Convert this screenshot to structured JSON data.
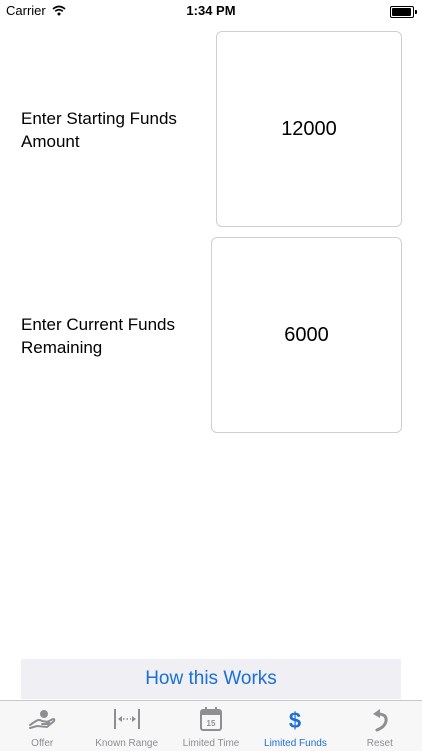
{
  "status_bar": {
    "carrier": "Carrier",
    "time": "1:34 PM"
  },
  "form": {
    "starting_funds_label": "Enter Starting Funds Amount",
    "starting_funds_value": "12000",
    "current_funds_label": "Enter Current Funds Remaining",
    "current_funds_value": "6000"
  },
  "how_button": {
    "label": "How this Works"
  },
  "tabs": [
    {
      "label": "Offer",
      "icon": "offer-hand-icon"
    },
    {
      "label": "Known Range",
      "icon": "range-icon"
    },
    {
      "label": "Limited Time",
      "icon": "calendar-icon",
      "calendar_day": "15"
    },
    {
      "label": "Limited Funds",
      "icon": "dollar-icon",
      "glyph": "$",
      "active": true
    },
    {
      "label": "Reset",
      "icon": "reset-icon"
    }
  ],
  "colors": {
    "accent": "#1a6fd9",
    "tab_inactive": "#8e8e93",
    "button_bg": "#efeff4"
  }
}
